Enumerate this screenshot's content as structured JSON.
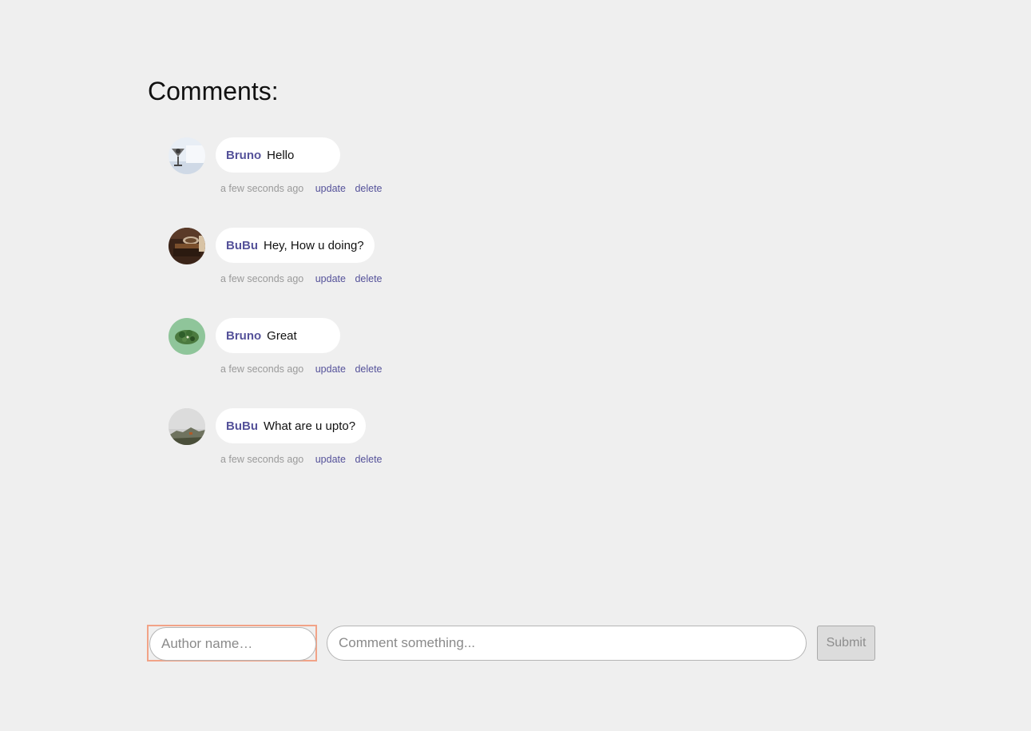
{
  "page": {
    "title": "Comments:"
  },
  "comments": [
    {
      "avatar_icon": "cocktail-photo-avatar",
      "author": "Bruno",
      "text": "Hello",
      "time": "a few seconds ago",
      "update_label": "update",
      "delete_label": "delete"
    },
    {
      "avatar_icon": "coffee-table-photo-avatar",
      "author": "BuBu",
      "text": "Hey, How u doing?",
      "time": "a few seconds ago",
      "update_label": "update",
      "delete_label": "delete"
    },
    {
      "avatar_icon": "salad-photo-avatar",
      "author": "Bruno",
      "text": "Great",
      "time": "a few seconds ago",
      "update_label": "update",
      "delete_label": "delete"
    },
    {
      "avatar_icon": "landscape-photo-avatar",
      "author": "BuBu",
      "text": "What are u upto?",
      "time": "a few seconds ago",
      "update_label": "update",
      "delete_label": "delete"
    }
  ],
  "form": {
    "author_placeholder": "Author name…",
    "author_value": "",
    "comment_placeholder": "Comment something...",
    "comment_value": "",
    "submit_label": "Submit"
  },
  "colors": {
    "background": "#efefef",
    "author_name": "#55529a",
    "action_link": "#55529a",
    "timestamp": "#9a9a9a",
    "focus_outline": "#f2a387"
  }
}
